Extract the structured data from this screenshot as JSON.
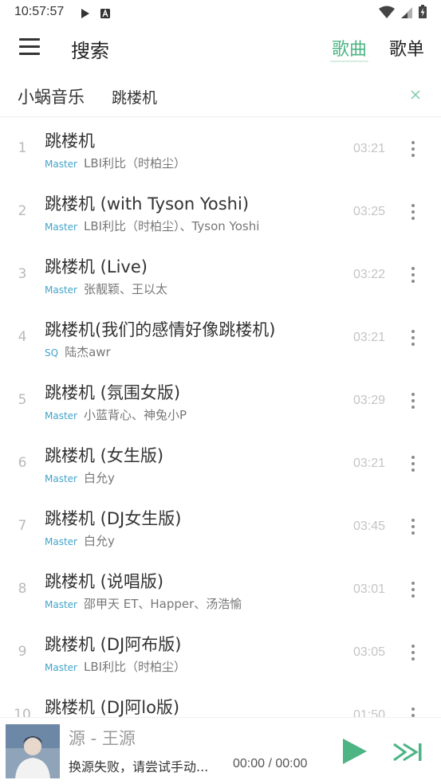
{
  "status_bar": {
    "time": "10:57:57",
    "left_icons": [
      "play-icon",
      "notification-a-icon"
    ],
    "right_icons": [
      "wifi-icon",
      "signal-icon",
      "battery-charging-icon"
    ]
  },
  "header": {
    "title": "搜索",
    "tabs": [
      {
        "label": "歌曲",
        "active": true
      },
      {
        "label": "歌单",
        "active": false
      }
    ],
    "accent_color": "#4db484"
  },
  "search": {
    "source": "小蜗音乐",
    "query": "跳楼机"
  },
  "results": [
    {
      "index": "1",
      "title": "跳楼机",
      "quality": "Master",
      "artist": "LBI利比（时柏尘）",
      "duration": "03:21"
    },
    {
      "index": "2",
      "title": "跳楼机 (with Tyson Yoshi)",
      "quality": "Master",
      "artist": "LBI利比（时柏尘）、Tyson Yoshi",
      "duration": "03:25"
    },
    {
      "index": "3",
      "title": "跳楼机 (Live)",
      "quality": "Master",
      "artist": "张靓颖、王以太",
      "duration": "03:22"
    },
    {
      "index": "4",
      "title": "跳楼机(我们的感情好像跳楼机)",
      "quality": "SQ",
      "artist": "陆杰awr",
      "duration": "03:21"
    },
    {
      "index": "5",
      "title": "跳楼机 (氛围女版)",
      "quality": "Master",
      "artist": "小蓝背心、神兔小P",
      "duration": "03:29"
    },
    {
      "index": "6",
      "title": "跳楼机 (女生版)",
      "quality": "Master",
      "artist": "白允y",
      "duration": "03:21"
    },
    {
      "index": "7",
      "title": "跳楼机 (DJ女生版)",
      "quality": "Master",
      "artist": "白允y",
      "duration": "03:45"
    },
    {
      "index": "8",
      "title": "跳楼机 (说唱版)",
      "quality": "Master",
      "artist": "邵甲天 ET、Happer、汤浩愉",
      "duration": "03:01"
    },
    {
      "index": "9",
      "title": "跳楼机 (DJ阿布版)",
      "quality": "Master",
      "artist": "LBI利比（时柏尘）",
      "duration": "03:05"
    },
    {
      "index": "10",
      "title": "跳楼机 (DJ阿lo版)",
      "quality": "",
      "artist": "",
      "duration": "01:50"
    }
  ],
  "player": {
    "title": "源 - 王源",
    "status": "换源失败，请尝试手动...",
    "time": "00:00 / 00:00",
    "play_color": "#4db484"
  }
}
